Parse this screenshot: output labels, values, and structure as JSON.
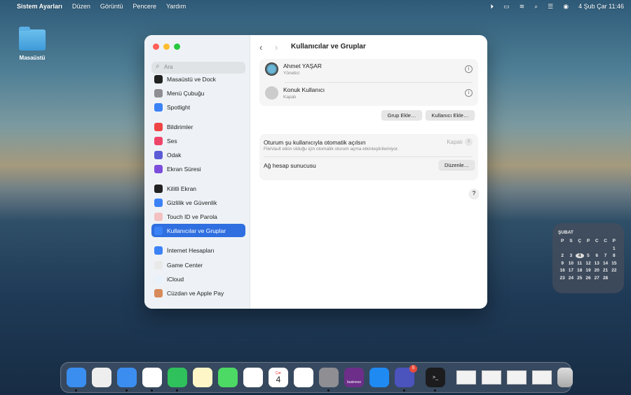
{
  "menubar": {
    "apple": "",
    "app": "Sistem Ayarları",
    "items": [
      "Düzen",
      "Görüntü",
      "Pencere",
      "Yardım"
    ],
    "datetime": "4 Şub Çar  11:46"
  },
  "desktop": {
    "folder": "Masaüstü"
  },
  "sidebar": {
    "search_placeholder": "Ara",
    "items": [
      {
        "label": "Masaüstü ve Dock",
        "color": "#222"
      },
      {
        "label": "Menü Çubuğu",
        "color": "#8e8e93"
      },
      {
        "label": "Spotlight",
        "color": "#3b82f6"
      },
      {
        "label": "Bildirimler",
        "color": "#ef4444"
      },
      {
        "label": "Ses",
        "color": "#ef4468"
      },
      {
        "label": "Odak",
        "color": "#5b5bd6"
      },
      {
        "label": "Ekran Süresi",
        "color": "#7c4ddb"
      },
      {
        "label": "Kilitli Ekran",
        "color": "#222"
      },
      {
        "label": "Gizlilik ve Güvenlik",
        "color": "#3b82f6"
      },
      {
        "label": "Touch ID ve Parola",
        "color": "#f3c1c1"
      },
      {
        "label": "Kullanıcılar ve Gruplar",
        "color": "#3b82f6",
        "selected": true
      },
      {
        "label": "İnternet Hesapları",
        "color": "#3b82f6"
      },
      {
        "label": "Game Center",
        "color": "#e9e9e9"
      },
      {
        "label": "iCloud",
        "color": "#e9f2fb"
      },
      {
        "label": "Cüzdan ve Apple Pay",
        "color": "#d78a5a"
      }
    ]
  },
  "main": {
    "title": "Kullanıcılar ve Gruplar",
    "users": [
      {
        "name": "Ahmet YAŞAR",
        "role": "Yönetici"
      },
      {
        "name": "Konuk Kullanıcı",
        "role": "Kapalı"
      }
    ],
    "buttons": {
      "add_group": "Grup Ekle…",
      "add_user": "Kullanıcı Ekle…",
      "edit": "Düzenle…",
      "help": "?"
    },
    "autologin": {
      "label": "Oturum şu kullanıcıyla otomatik açılsın",
      "note": "FileVault etkin olduğu için otomatik oturum açma etkinleştirilemiyor.",
      "value": "Kapalı"
    },
    "network": {
      "label": "Ağ hesap sunucusu"
    }
  },
  "calendar": {
    "month": "ŞUBAT",
    "weekdays": [
      "P",
      "S",
      "Ç",
      "P",
      "C",
      "C",
      "P"
    ],
    "today": 4,
    "days_in_month": 28,
    "first_weekday_index": 6
  },
  "dock": {
    "apps": [
      "Finder",
      "Launchpad",
      "Safari",
      "Chrome",
      "WhatsApp",
      "Notlar",
      "Mesajlar",
      "Fotoğraflar",
      "Takvim",
      "Anımsatıcılar",
      "Sistem Ayarları",
      "Business",
      "App Store",
      "Teams",
      "Terminal"
    ],
    "calendar_day": "Çar",
    "calendar_date": "4",
    "teams_badge": "5",
    "chrome_label": "",
    "business_label": "business"
  }
}
